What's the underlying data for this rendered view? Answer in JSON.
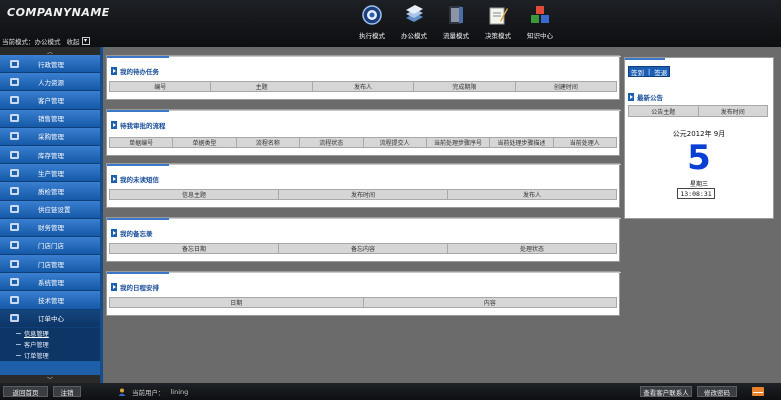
{
  "header": {
    "company": "COMPANYNAME",
    "mode_label": "当前模式：",
    "mode_value": "办公模式",
    "collapse_label": "收起",
    "collapse_toggle": "▾",
    "nav": [
      {
        "label": "执行模式",
        "icon": "clock-globe-icon"
      },
      {
        "label": "办公模式",
        "icon": "document-stack-icon"
      },
      {
        "label": "流量模式",
        "icon": "book-icon"
      },
      {
        "label": "决策模式",
        "icon": "signing-pen-icon"
      },
      {
        "label": "知识中心",
        "icon": "colored-cubes-icon"
      }
    ]
  },
  "sidebar": {
    "up_arrow": "︿",
    "down_arrow": "﹀",
    "items": [
      {
        "label": "行政管理",
        "icon": "people-icon"
      },
      {
        "label": "人力资源",
        "icon": "person-icon"
      },
      {
        "label": "客户管理",
        "icon": "clipboard-icon"
      },
      {
        "label": "销售管理",
        "icon": "cash-register-icon"
      },
      {
        "label": "采购管理",
        "icon": "truck-icon"
      },
      {
        "label": "库存管理",
        "icon": "warehouse-icon"
      },
      {
        "label": "生产管理",
        "icon": "factory-icon"
      },
      {
        "label": "质检管理",
        "icon": "inspect-icon"
      },
      {
        "label": "供应链设置",
        "icon": "link-icon"
      },
      {
        "label": "财务管理",
        "icon": "money-icon"
      },
      {
        "label": "门店门店",
        "icon": "store-icon"
      },
      {
        "label": "门店管理",
        "icon": "shop-icon"
      },
      {
        "label": "系统管理",
        "icon": "gear-icon"
      },
      {
        "label": "技术管理",
        "icon": "tools-icon"
      },
      {
        "label": "订单中心",
        "icon": "order-icon"
      }
    ],
    "subitems": [
      "信息管理",
      "客户管理",
      "订单管理"
    ]
  },
  "panels": [
    {
      "title": "我的待办任务",
      "columns": [
        "编号",
        "主题",
        "发布人",
        "完成期限",
        "创建时间"
      ]
    },
    {
      "title": "待我审批的流程",
      "columns": [
        "单据编号",
        "单据类型",
        "流程名称",
        "流程状态",
        "流程提交人",
        "当前处理步骤序号",
        "当前处理步骤描述",
        "当前处理人"
      ]
    },
    {
      "title": "我的未读短信",
      "columns": [
        "信息主题",
        "发布时间",
        "发布人"
      ]
    },
    {
      "title": "我的备忘录",
      "columns": [
        "备忘日期",
        "备忘内容",
        "处理状态"
      ]
    },
    {
      "title": "我的日程安排",
      "columns": [
        "日期",
        "内容"
      ]
    }
  ],
  "right": {
    "tabs": [
      "签到",
      "签退"
    ],
    "tab_sep": "|",
    "notice_title": "最新公告",
    "columns": [
      "公告主题",
      "发布时间"
    ],
    "cal_year_month": "公元2012年 9月",
    "cal_day": "5",
    "cal_weekday": "星期三",
    "cal_time": "13:08:31"
  },
  "footer": {
    "home_button": "返回首页",
    "logout_button": "注销",
    "current_user_label": "当前用户：",
    "current_user": "lining",
    "contact_button": "查看客户联系人",
    "change_pw_button": "修改密码"
  }
}
